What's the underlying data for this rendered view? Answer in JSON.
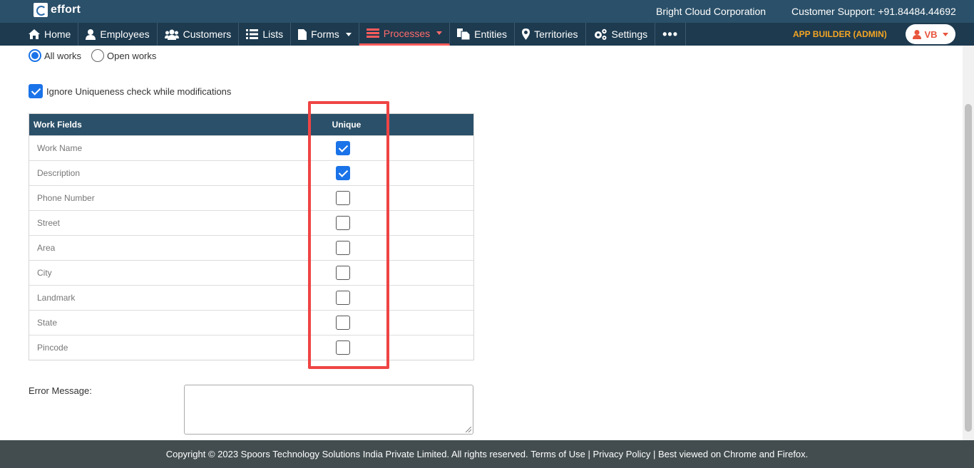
{
  "header": {
    "logo_text": "effort",
    "company": "Bright Cloud Corporation",
    "support": "Customer Support: +91.84484.44692"
  },
  "nav": {
    "items": [
      {
        "label": "Home",
        "icon": "home-icon"
      },
      {
        "label": "Employees",
        "icon": "user-icon"
      },
      {
        "label": "Customers",
        "icon": "users-icon"
      },
      {
        "label": "Lists",
        "icon": "list-icon"
      },
      {
        "label": "Forms",
        "icon": "file-icon",
        "dropdown": true
      },
      {
        "label": "Processes",
        "icon": "process-icon",
        "dropdown": true,
        "active": true
      },
      {
        "label": "Entities",
        "icon": "copy-icon"
      },
      {
        "label": "Territories",
        "icon": "map-marker-icon"
      },
      {
        "label": "Settings",
        "icon": "gears-icon"
      }
    ],
    "more": "•••",
    "app_builder": "APP BUILDER (ADMIN)",
    "user_initials": "VB"
  },
  "filter": {
    "all_works": "All works",
    "open_works": "Open works",
    "selected": "all_works"
  },
  "ignore_uniqueness": {
    "label": "Ignore Uniqueness check while modifications",
    "checked": true
  },
  "table": {
    "col_fields": "Work Fields",
    "col_unique": "Unique",
    "rows": [
      {
        "field": "Work Name",
        "unique": true
      },
      {
        "field": "Description",
        "unique": true
      },
      {
        "field": "Phone Number",
        "unique": false
      },
      {
        "field": "Street",
        "unique": false
      },
      {
        "field": "Area",
        "unique": false
      },
      {
        "field": "City",
        "unique": false
      },
      {
        "field": "Landmark",
        "unique": false
      },
      {
        "field": "State",
        "unique": false
      },
      {
        "field": "Pincode",
        "unique": false
      }
    ]
  },
  "error_message": {
    "label": "Error Message:",
    "value": ""
  },
  "footer": {
    "copyright": "Copyright © 2023 Spoors Technology Solutions India Private Limited. All rights reserved.",
    "terms": "Terms of Use",
    "privacy": "Privacy Policy",
    "best_viewed": "Best viewed on Chrome and Firefox."
  },
  "colors": {
    "header_bg": "#2b5069",
    "nav_bg": "#1d3a4f",
    "active_nav": "#ff5b5b",
    "app_builder": "#f5a623",
    "highlight": "#ef4444",
    "checkbox": "#1a73e8"
  }
}
